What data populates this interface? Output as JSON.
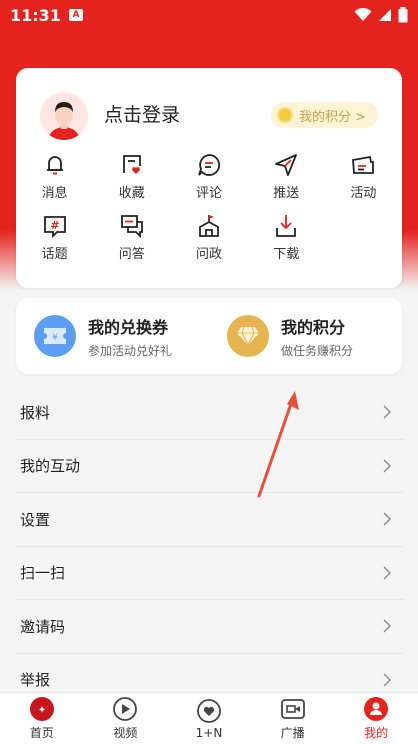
{
  "status_bar": {
    "time": "11:31",
    "sim_label": "A"
  },
  "profile": {
    "login_text": "点击登录",
    "points_label": "我的积分 >"
  },
  "quick_grid": [
    {
      "label": "消息",
      "icon": "bell-icon"
    },
    {
      "label": "收藏",
      "icon": "favorite-icon"
    },
    {
      "label": "评论",
      "icon": "comment-icon"
    },
    {
      "label": "推送",
      "icon": "send-icon"
    },
    {
      "label": "活动",
      "icon": "ticket-icon"
    },
    {
      "label": "话题",
      "icon": "topic-icon"
    },
    {
      "label": "问答",
      "icon": "qa-icon"
    },
    {
      "label": "问政",
      "icon": "government-icon"
    },
    {
      "label": "下载",
      "icon": "download-icon"
    }
  ],
  "promo": {
    "coupon": {
      "title": "我的兑换券",
      "subtitle": "参加活动兑好礼",
      "color": "#5d9ef0"
    },
    "points": {
      "title": "我的积分",
      "subtitle": "做任务赚积分",
      "color": "#e6b450"
    }
  },
  "menu": [
    "报料",
    "我的互动",
    "设置",
    "扫一扫",
    "邀请码",
    "举报"
  ],
  "tabs": [
    {
      "label": "首页",
      "icon": "home-logo-icon"
    },
    {
      "label": "视频",
      "icon": "video-play-icon"
    },
    {
      "label": "1+N",
      "icon": "heart-icon"
    },
    {
      "label": "广播",
      "icon": "radio-icon"
    },
    {
      "label": "我的",
      "icon": "profile-icon",
      "active": true
    }
  ],
  "colors": {
    "brand_red": "#e4231e",
    "gold": "#caa43f"
  }
}
